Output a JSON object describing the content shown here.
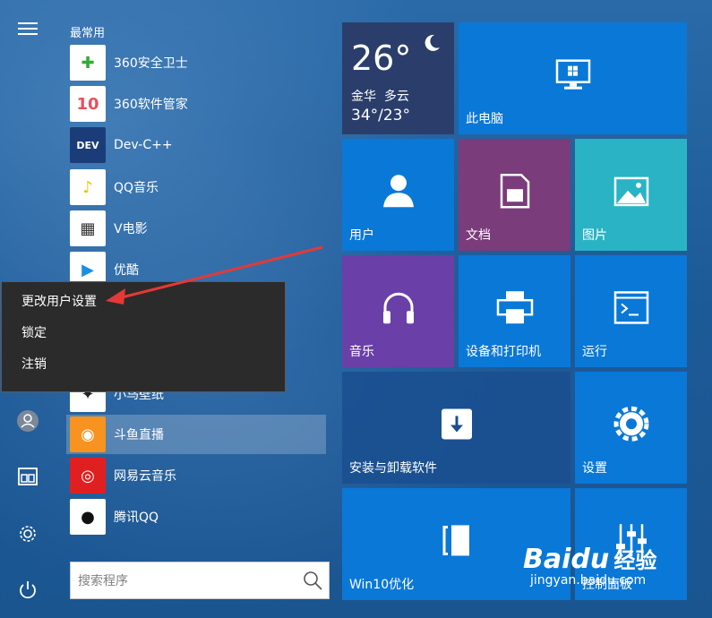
{
  "section_title": "最常用",
  "apps": [
    {
      "label": "360安全卫士",
      "icon": "360-safe-icon",
      "bg": "#ffffff",
      "fg": "#33aa33",
      "glyph": "✚"
    },
    {
      "label": "360软件管家",
      "icon": "360-software-icon",
      "bg": "#ffffff",
      "fg": "#e8505b",
      "glyph": "10"
    },
    {
      "label": "Dev-C++",
      "icon": "devcpp-icon",
      "bg": "#1a3d7a",
      "fg": "#ffffff",
      "glyph": "DEV"
    },
    {
      "label": "QQ音乐",
      "icon": "qqmusic-icon",
      "bg": "#ffffff",
      "fg": "#f2c20a",
      "glyph": "♪"
    },
    {
      "label": "V电影",
      "icon": "vmovie-icon",
      "bg": "#ffffff",
      "fg": "#333333",
      "glyph": "▦"
    },
    {
      "label": "优酷",
      "icon": "youku-icon",
      "bg": "#ffffff",
      "fg": "#1a8fe3",
      "glyph": "▶"
    },
    {
      "label": "小鸟壁纸",
      "icon": "bird-wallpaper-icon",
      "bg": "#ffffff",
      "fg": "#222222",
      "glyph": "✦"
    },
    {
      "label": "斗鱼直播",
      "icon": "douyu-icon",
      "bg": "#f7931e",
      "fg": "#ffffff",
      "glyph": "◉"
    },
    {
      "label": "网易云音乐",
      "icon": "netease-music-icon",
      "bg": "#e02020",
      "fg": "#ffffff",
      "glyph": "◎"
    },
    {
      "label": "腾讯QQ",
      "icon": "qq-penguin-icon",
      "bg": "#ffffff",
      "fg": "#111111",
      "glyph": "●"
    }
  ],
  "search_placeholder": "搜索程序",
  "context_menu": [
    "更改用户设置",
    "锁定",
    "注销"
  ],
  "weather": {
    "temp": "26°",
    "city": "金华",
    "condition": "多云",
    "range": "34°/23°"
  },
  "tiles": {
    "this_pc": "此电脑",
    "user": "用户",
    "docs": "文档",
    "pictures": "图片",
    "music": "音乐",
    "devices": "设备和打印机",
    "run": "运行",
    "install": "安装与卸载软件",
    "settings": "设置",
    "win10": "Win10优化",
    "control_panel": "控制面板"
  },
  "watermark": {
    "brand": "Baidu",
    "sub": "经验",
    "url": "jingyan.baidu.com"
  },
  "colors": {
    "tile_blue": "#0a78d7",
    "tile_purple_docs": "#7a3c7a",
    "tile_teal": "#2ab3c4",
    "tile_purple_music": "#6a3fa8",
    "tile_navy": "#1a4f8f",
    "arrow_red": "#e53935"
  }
}
